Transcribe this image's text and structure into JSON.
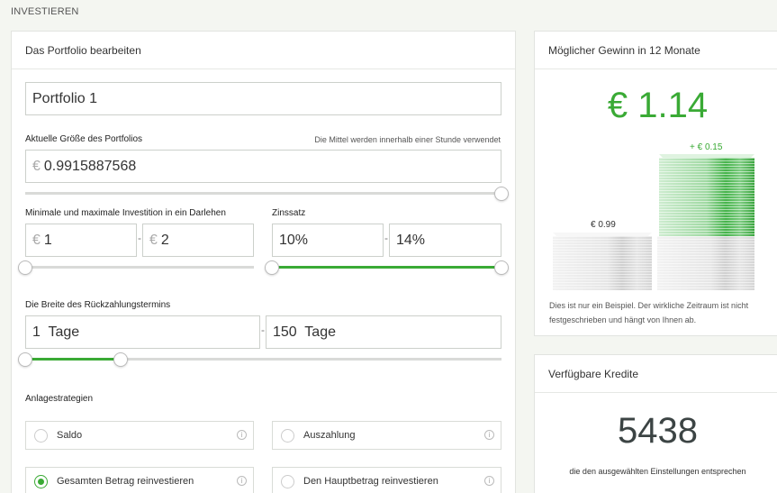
{
  "section": {
    "title": "INVESTIEREN"
  },
  "editor": {
    "title": "Das Portfolio bearbeiten",
    "portfolio_name": "Portfolio 1",
    "size_label": "Aktuelle Größe des Portfolios",
    "size_hint": "Die Mittel werden innerhalb einer Stunde verwendet",
    "currency": "€",
    "size_value": "0.9915887568",
    "size_slider_fraction": 1.0,
    "invest_label": "Minimale und maximale Investition in ein Darlehen",
    "invest_min": "1",
    "invest_max": "2",
    "invest_slider": {
      "min_fraction": 0.0,
      "max_fraction": 0.0
    },
    "rate_label": "Zinssatz",
    "rate_min": "10%",
    "rate_max": "14%",
    "rate_slider": {
      "min_fraction": 0.0,
      "max_fraction": 1.0
    },
    "term_label": "Die Breite des Rückzahlungstermins",
    "term_min": "1  Tage",
    "term_max": "150  Tage",
    "term_slider": {
      "min_fraction": 0.0,
      "max_fraction": 0.2
    },
    "separator": "-",
    "strategies_label": "Anlagestrategien",
    "strategies": [
      {
        "label": "Saldo",
        "selected": false
      },
      {
        "label": "Auszahlung",
        "selected": false
      },
      {
        "label": "Gesamten Betrag reinvestieren",
        "selected": true
      },
      {
        "label": "Den Hauptbetrag reinvestieren",
        "selected": false
      }
    ]
  },
  "profit": {
    "title": "Möglicher Gewinn in 12 Monate",
    "value": "€ 1.14",
    "base_label": "€ 0.99",
    "gain_label": "+ € 0.15",
    "disclaimer": "Dies ist nur ein Beispiel. Der wirkliche Zeitraum ist nicht festgeschrieben und hängt von Ihnen ab.",
    "accent": "#3aaa35"
  },
  "loans": {
    "title": "Verfügbare Kredite",
    "count": "5438",
    "subtitle": "die den ausgewählten Einstellungen entsprechen"
  }
}
